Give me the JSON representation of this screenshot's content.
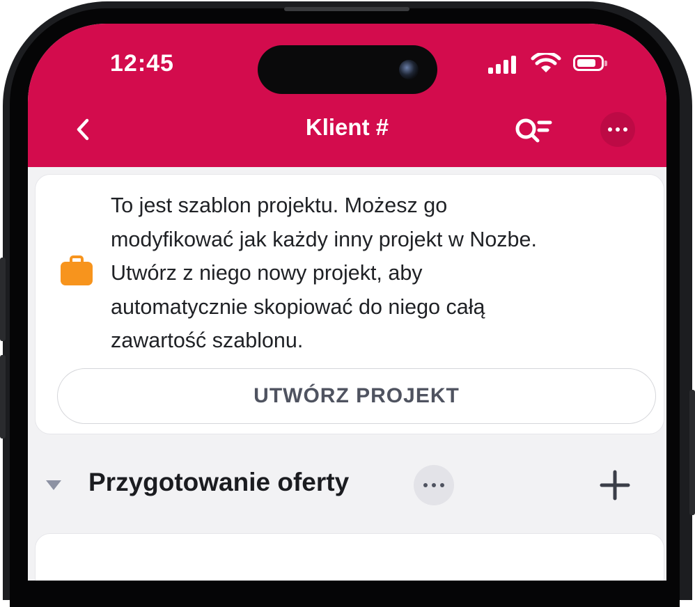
{
  "status_bar": {
    "time": "12:45",
    "icons": [
      "signal-icon",
      "wifi-icon",
      "battery-icon"
    ]
  },
  "nav": {
    "title": "Klient #",
    "back_icon": "chevron-left-icon",
    "search_icon": "search-filter-icon",
    "more_icon": "more-horizontal-icon"
  },
  "template_notice": {
    "icon": "briefcase-icon",
    "lines": [
      "To jest szablon projektu. Możesz go",
      "modyfikować jak każdy inny projekt w Nozbe.",
      "Utwórz z niego nowy projekt, aby",
      "automatycznie skopiować do niego całą",
      "zawartość szablonu."
    ],
    "button_label": "UTWÓRZ PROJEKT"
  },
  "section": {
    "title": "Przygotowanie oferty",
    "collapse_icon": "triangle-down-icon",
    "more_icon": "more-horizontal-icon",
    "add_icon": "plus-icon"
  },
  "colors": {
    "header": "#d30c4d",
    "briefcase": "#f7941d",
    "background": "#f2f2f4"
  }
}
